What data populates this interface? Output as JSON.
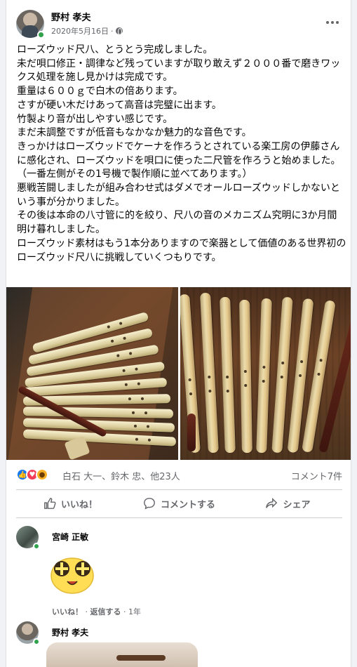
{
  "post": {
    "author": "野村 孝夫",
    "date": "2020年5月16日",
    "date_separator": "·",
    "text": "ローズウッド尺八、とうとう完成しました。\n未だ唄口修正・調律など残っていますが取り敢えず２０００番で磨きワックス処理を施し見かけは完成です。\n重量は６００ｇで白木の倍あります。\nさすが硬い木だけあって高音は完璧に出ます。\n竹製より音が出しやすい感じです。\nまだ未調整ですが低音もなかなか魅力的な音色です。\nきっかけはローズウッドでケーナを作ろうとされている楽工房の伊藤さんに感化され、ローズウッドを唄口に使った二尺管を作ろうと始めました。\n（一番左側がその1号機で製作順に並べてあります。）\n悪戦苦闘しましたが組み合わせ式はダメでオールローズウッドしかないという事が分かりました。\nその後は本命の八寸管に的を絞り、尺八の音のメカニズム究明に3か月間明け暮れしました。\nローズウッド素材はもう1本分ありますので楽器として価値のある世界初のローズウッド尺八に挑戦していくつもりです。"
  },
  "stats": {
    "reactors": "白石 大一、鈴木 忠、他23人",
    "comments": "コメント7件"
  },
  "actions": {
    "like": "いいね！",
    "comment": "コメントする",
    "share": "シェア"
  },
  "comments": [
    {
      "author": "宮崎 正敏",
      "like": "いいね！",
      "reply": "返信する",
      "age": "1年",
      "sep": "·"
    },
    {
      "author": "野村 孝夫"
    }
  ],
  "colors": {
    "brand_blue": "#1877f2",
    "online_green": "#31a24c",
    "meta_gray": "#65676b"
  }
}
